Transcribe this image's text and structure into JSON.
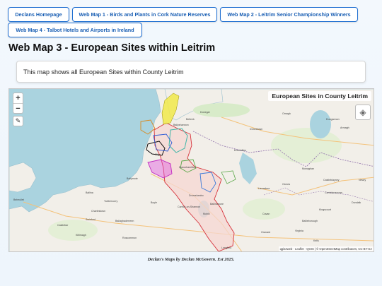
{
  "nav": {
    "buttons": [
      {
        "label": "Declans Homepage"
      },
      {
        "label": "Web Map 1 - Birds and Plants in Cork Nature Reserves"
      },
      {
        "label": "Web Map 2 - Leitrim Senior Championship Winners"
      },
      {
        "label": "Web Map 4 - Talbot Hotels and Airports in Ireland"
      }
    ]
  },
  "page": {
    "title": "Web Map 3 - European Sites within Leitrim",
    "description": "This map shows all European Sites within County Leitrim"
  },
  "map": {
    "title": "European Sites in County Leitrim",
    "zoom_in": "+",
    "zoom_out": "−",
    "attribution": "qgis2web · Leaflet · QGIS | © OpenStreetMap contributors, CC-BY-SA",
    "colors": {
      "sea": "#aad3df",
      "land": "#f2efe9",
      "county": "#f6d7d2",
      "county_border": "#d6313a"
    },
    "towns": [
      "Donegal",
      "Sligo",
      "Ballyshannon",
      "Enniskillen",
      "Omagh",
      "Dungannon",
      "Armagh",
      "Monaghan",
      "Cavan",
      "Carrick-on-Shannon",
      "Roscommon",
      "Boyle",
      "Longford",
      "Belmullet",
      "Ballina",
      "Castlebar",
      "Manorhamilton",
      "Lisnaskea",
      "Clones",
      "Newry",
      "Dundalk",
      "Ballymote",
      "Tubbercurry",
      "Mohill",
      "Drumshanbo",
      "Ballinamore",
      "Belleek",
      "Irvinestown",
      "Castleblayney",
      "Carrickmacross",
      "Kingscourt",
      "Virginia",
      "Bailieborough",
      "Granard",
      "Kells",
      "Swinford",
      "Kiltimagh",
      "Ballaghaderreen",
      "Charlestown"
    ]
  },
  "footer": {
    "text": "Declan's Maps by Declan McGovern. Est 2025."
  }
}
